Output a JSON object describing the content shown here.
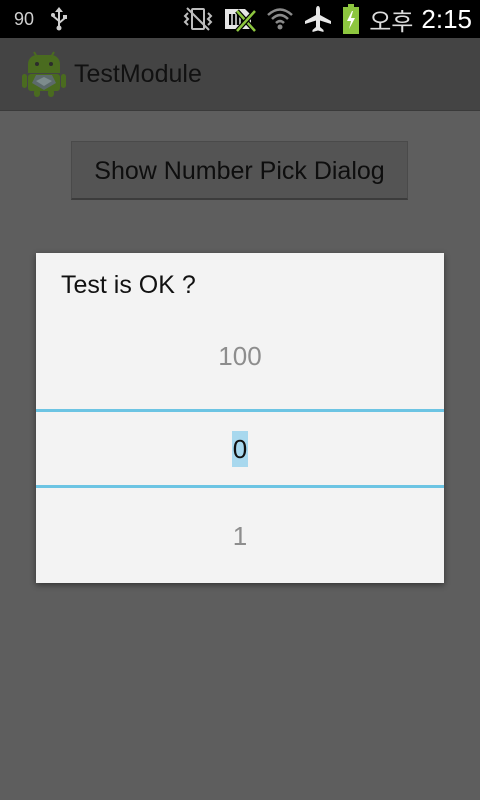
{
  "status_bar": {
    "notification_count": "90",
    "ampm": "오후",
    "time": "2:15",
    "icons": [
      "usb-icon",
      "vibrate-mute-icon",
      "no-sim-icon",
      "wifi-icon",
      "airplane-icon",
      "battery-charging-icon"
    ]
  },
  "action_bar": {
    "title": "TestModule",
    "icon": "android-icon"
  },
  "main": {
    "button_label": "Show Number Pick Dialog"
  },
  "dialog": {
    "title": "Test is OK ?",
    "picker": {
      "previous": "100",
      "current": "0",
      "next": "1"
    }
  },
  "colors": {
    "status_bar_bg": "#000000",
    "dim_overlay": "#5e5e5e",
    "dialog_bg": "#f3f3f3",
    "picker_divider": "#6cc4e3",
    "selection_highlight": "#a8d8ee",
    "battery_green": "#8dc63f"
  }
}
